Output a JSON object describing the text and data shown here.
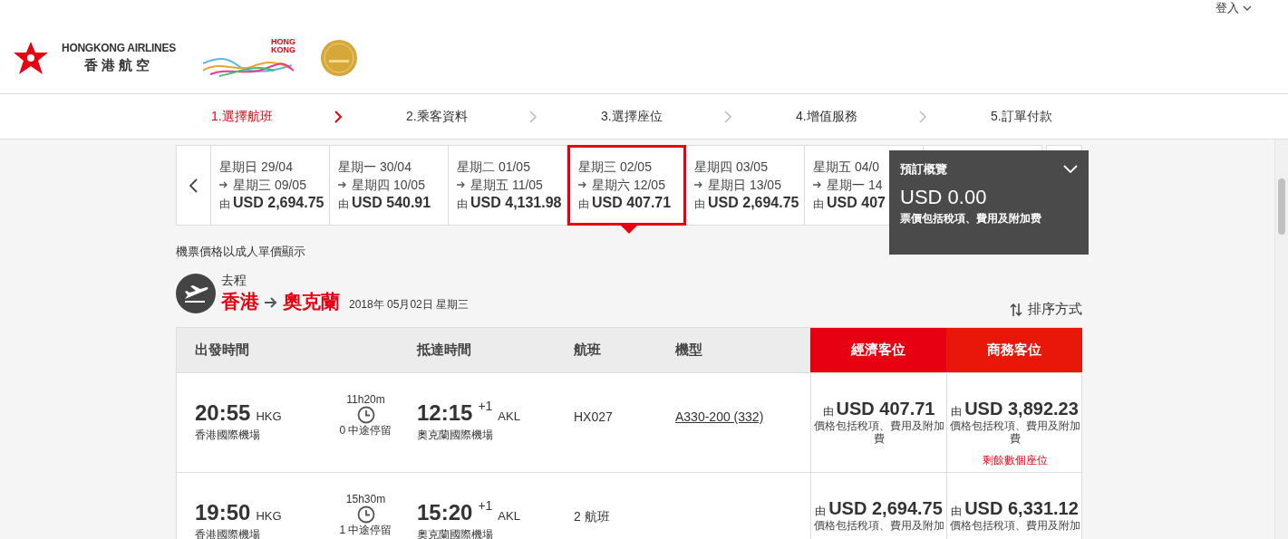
{
  "header": {
    "login": "登入",
    "airline_en": "HONGKONG AIRLINES",
    "airline_zh": "香港航空",
    "brand": [
      "HONG",
      "KONG"
    ]
  },
  "steps": [
    {
      "label": "1.選擇航班",
      "selected": true
    },
    {
      "label": "2.乘客資料",
      "selected": false
    },
    {
      "label": "3.選擇座位",
      "selected": false
    },
    {
      "label": "4.增值服務",
      "selected": false
    },
    {
      "label": "5.訂單付款",
      "selected": false
    }
  ],
  "dates": [
    {
      "depart": "星期日 29/04",
      "return": "星期三 09/05",
      "prefix": "由",
      "price": "USD 2,694.75",
      "selected": false
    },
    {
      "depart": "星期一 30/04",
      "return": "星期四 10/05",
      "prefix": "由",
      "price": "USD 540.91",
      "selected": false
    },
    {
      "depart": "星期二 01/05",
      "return": "星期五 11/05",
      "prefix": "由",
      "price": "USD 4,131.98",
      "selected": false
    },
    {
      "depart": "星期三 02/05",
      "return": "星期六 12/05",
      "prefix": "由",
      "price": "USD 407.71",
      "selected": true
    },
    {
      "depart": "星期四 03/05",
      "return": "星期日 13/05",
      "prefix": "由",
      "price": "USD 2,694.75",
      "selected": false
    },
    {
      "depart": "星期五 04/0",
      "return": "星期一 14",
      "prefix": "由",
      "price": "USD 407",
      "selected": false
    }
  ],
  "summary": {
    "title": "預訂概覽",
    "total": "USD 0.00",
    "note": "票價包括稅項、費用及附加费"
  },
  "price_note": "機票價格以成人單價顯示",
  "trip": {
    "label": "去程",
    "origin": "香港",
    "destination": "奧克蘭",
    "date": "2018年 05月02日 星期三",
    "sort": "排序方式"
  },
  "table": {
    "columns": [
      {
        "label": "出發時間",
        "kind": "plain"
      },
      {
        "label": "抵達時間",
        "kind": "plain"
      },
      {
        "label": "航班",
        "kind": "plain"
      },
      {
        "label": "機型",
        "kind": "plain"
      },
      {
        "label": "經濟客位",
        "kind": "fare"
      },
      {
        "label": "商務客位",
        "kind": "fare"
      }
    ],
    "rows": [
      {
        "depart_time": "20:55",
        "depart_code": "HKG",
        "depart_airport": "香港國際機場",
        "duration": "11h20m",
        "stops": "0 中途停留",
        "arrive_time": "12:15",
        "day_offset": "+1",
        "arrive_code": "AKL",
        "arrive_airport": "奧克蘭國際機場",
        "flight": "HX027",
        "aircraft": "A330-200 (332)",
        "fares": [
          {
            "prefix": "由",
            "price": "USD 407.71",
            "note": "價格包括稅項、費用及附加費"
          },
          {
            "prefix": "由",
            "price": "USD 3,892.23",
            "note": "價格包括稅項、費用及附加費",
            "seats": "剩餘數個座位"
          }
        ]
      },
      {
        "depart_time": "19:50",
        "depart_code": "HKG",
        "depart_airport": "香港國際機場",
        "duration": "15h30m",
        "stops": "1 中途停留",
        "arrive_time": "15:20",
        "day_offset": "+1",
        "arrive_code": "AKL",
        "arrive_airport": "奧克蘭國際機場",
        "flight": "2 航班",
        "fares": [
          {
            "prefix": "由",
            "price": "USD 2,694.75",
            "note": "價格包括稅項、費用及附加"
          },
          {
            "prefix": "由",
            "price": "USD 6,331.12",
            "note": "價格包括稅項、費用及附加"
          }
        ]
      }
    ]
  }
}
